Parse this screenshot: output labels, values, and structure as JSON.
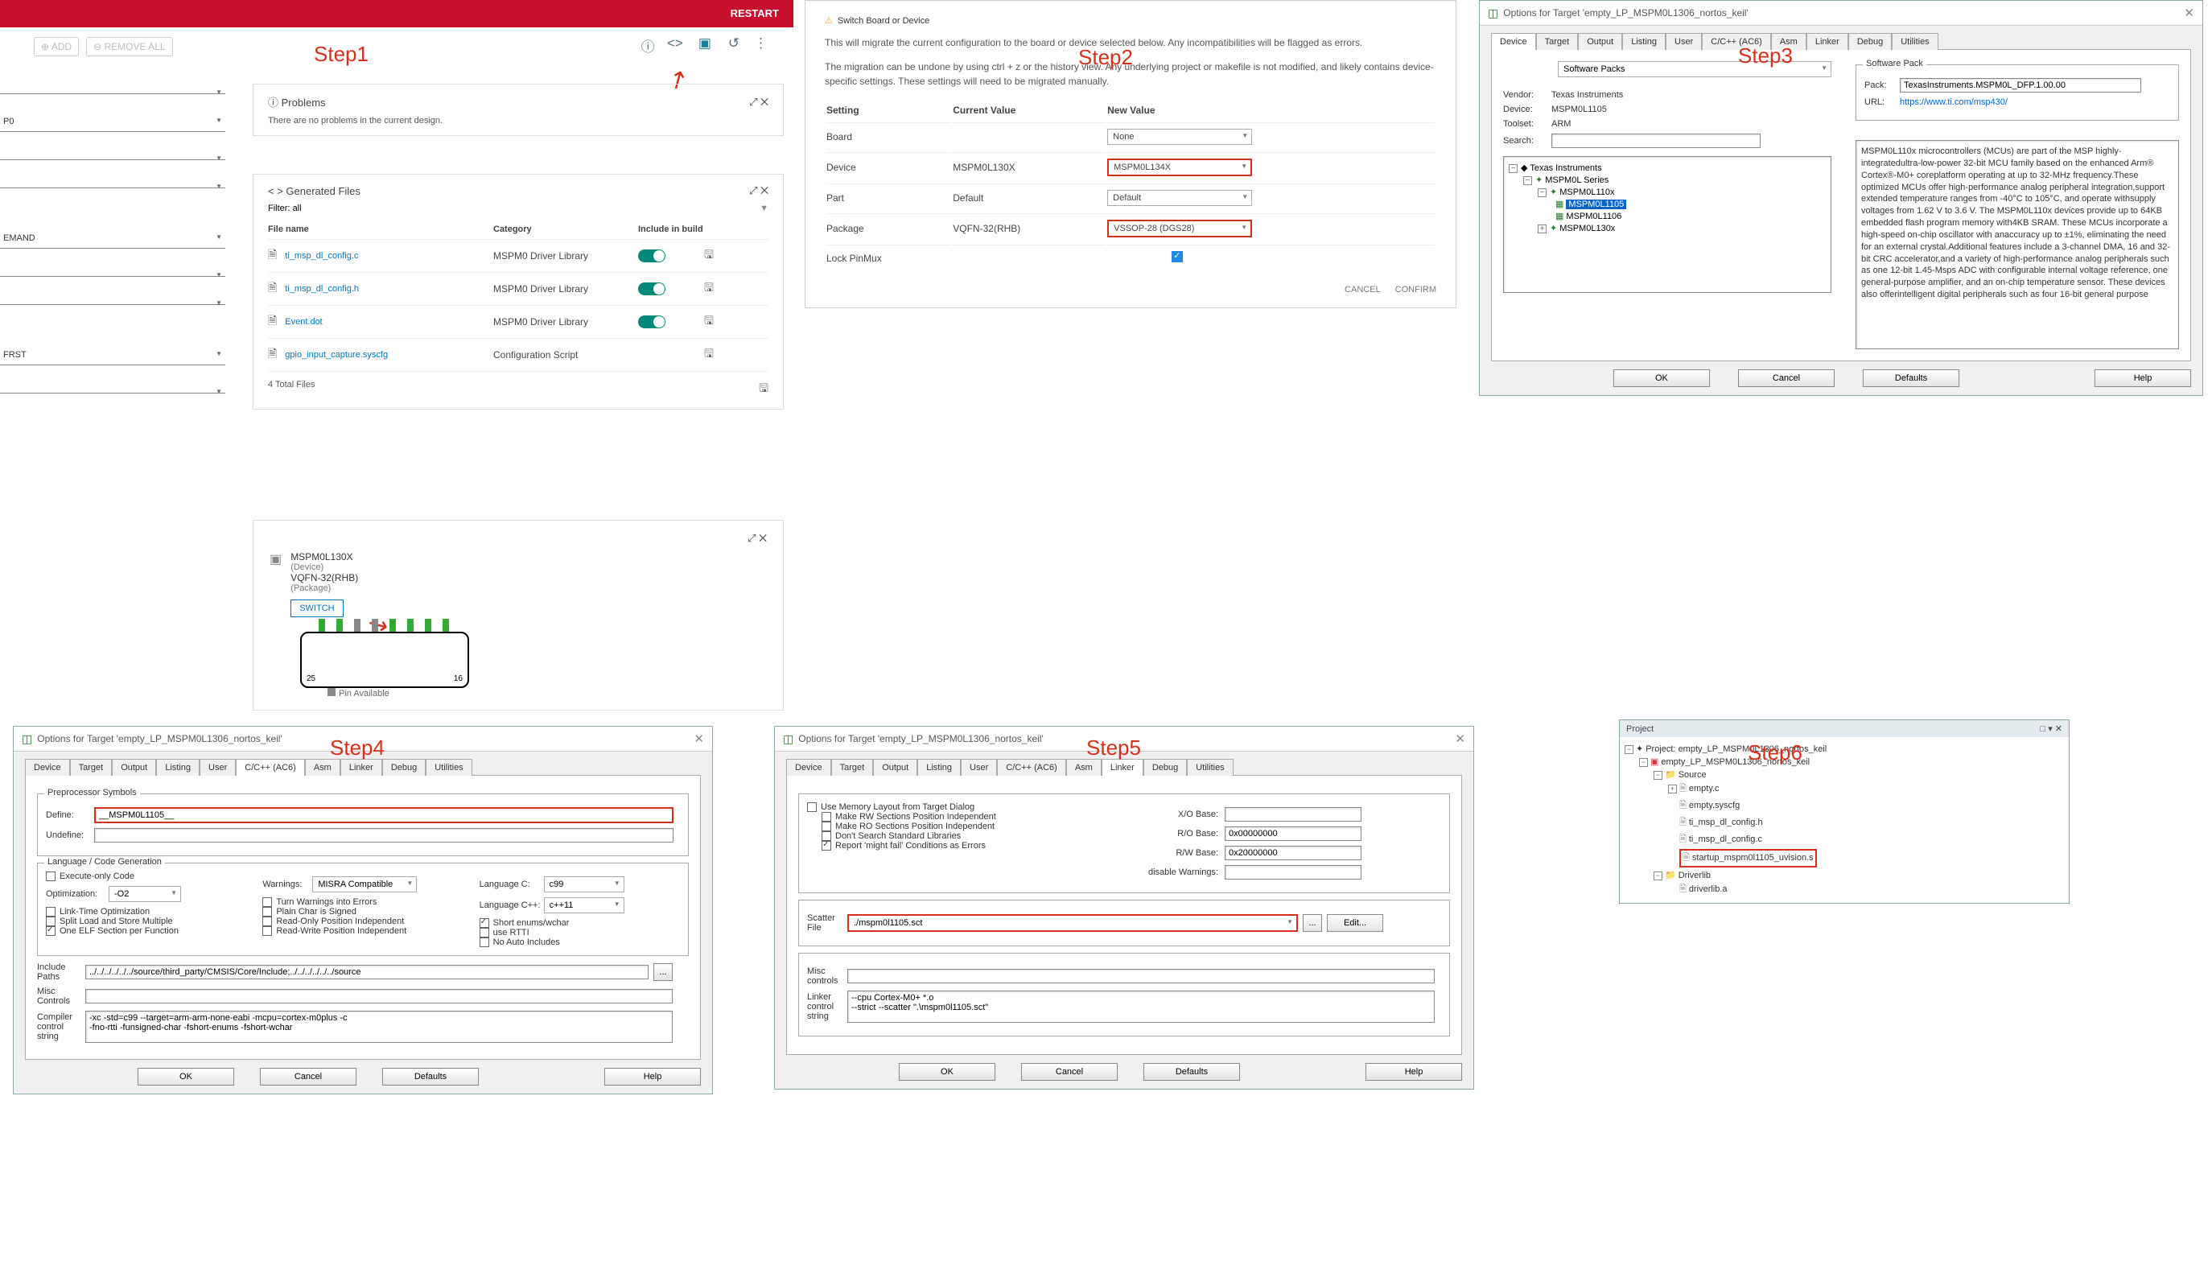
{
  "step_labels": [
    "Step1",
    "Step2",
    "Step3",
    "Step4",
    "Step5",
    "Step6"
  ],
  "restart": "RESTART",
  "left": {
    "add": "⊕ ADD",
    "remove": "⊖ REMOVE ALL",
    "drops": [
      "",
      "P0",
      "",
      "",
      "EMAND",
      "",
      "",
      "FRST",
      ""
    ]
  },
  "problems": {
    "title": "Problems",
    "msg": "There are no problems in the current design."
  },
  "genfiles": {
    "title": "Generated Files",
    "filter_lb": "Filter:",
    "filter": "all",
    "cols": [
      "File name",
      "Category",
      "Include in build"
    ],
    "rows": [
      {
        "name": "ti_msp_dl_config.c",
        "cat": "MSPM0 Driver Library",
        "tog": true
      },
      {
        "name": "ti_msp_dl_config.h",
        "cat": "MSPM0 Driver Library",
        "tog": true
      },
      {
        "name": "Event.dot",
        "cat": "MSPM0 Driver Library",
        "tog": true
      },
      {
        "name": "gpio_input_capture.syscfg",
        "cat": "Configuration Script",
        "tog": false
      }
    ],
    "total": "4 Total Files"
  },
  "device": {
    "name": "MSPM0L130X",
    "dev": "(Device)",
    "pkg": "VQFN-32(RHB)",
    "pkg2": "(Package)",
    "switch": "SWITCH",
    "pin_avail": "Pin Available",
    "p25": "25",
    "p16": "16"
  },
  "switchdlg": {
    "title": "Switch Board or Device",
    "p1": "This will migrate the current configuration to the board or device selected below. Any incompatibilities will be flagged as errors.",
    "p2": "The migration can be undone by using ctrl + z or the history view. Any underlying project or makefile is not modified, and likely contains device-specific settings. These settings will need to be migrated manually.",
    "cols": [
      "Setting",
      "Current Value",
      "New Value"
    ],
    "rows": [
      {
        "s": "Board",
        "c": "",
        "n": "None"
      },
      {
        "s": "Device",
        "c": "MSPM0L130X",
        "n": "MSPM0L134X"
      },
      {
        "s": "Part",
        "c": "Default",
        "n": "Default"
      },
      {
        "s": "Package",
        "c": "VQFN-32(RHB)",
        "n": "VSSOP-28 (DGS28)"
      },
      {
        "s": "Lock PinMux",
        "c": "",
        "n": "__check__"
      }
    ],
    "cancel": "CANCEL",
    "confirm": "CONFIRM"
  },
  "keil_dev": {
    "title": "Options for Target 'empty_LP_MSPM0L1306_nortos_keil'",
    "tabs": [
      "Device",
      "Target",
      "Output",
      "Listing",
      "User",
      "C/C++ (AC6)",
      "Asm",
      "Linker",
      "Debug",
      "Utilities"
    ],
    "soft": "Software Packs",
    "vendor_l": "Vendor:",
    "vendor": "Texas Instruments",
    "device_l": "Device:",
    "device": "MSPM0L1105",
    "tool_l": "Toolset:",
    "tool": "ARM",
    "search_l": "Search:",
    "tree": [
      "Texas Instruments",
      "MSPM0L Series",
      "MSPM0L110x",
      "MSPM0L1105",
      "MSPM0L1106",
      "MSPM0L130x"
    ],
    "sp_t": "Software Pack",
    "pack_l": "Pack:",
    "pack": "TexasInstruments.MSPM0L_DFP.1.00.00",
    "url_l": "URL:",
    "url": "https://www.ti.com/msp430/",
    "desc": "MSPM0L110x microcontrollers (MCUs) are part of the MSP highly-integratedultra-low-power 32-bit MCU family based on the enhanced Arm® Cortex®-M0+ coreplatform operating at up to 32-MHz frequency.These optimized MCUs offer high-performance analog peripheral integration,support extended temperature ranges from -40°C to 105°C, and operate withsupply voltages from 1.62 V to 3.6 V. The MSPM0L110x devices provide up to 64KB embedded flash program memory with4KB SRAM. These MCUs incorporate a high-speed on-chip oscillator with anaccuracy up to ±1%, eliminating the need for an external crystal.Additional features include a 3-channel DMA, 16 and 32-bit CRC accelerator,and a variety of high-performance analog peripherals such as one 12-bit 1.45-Msps ADC with configurable internal voltage reference, one general-purpose amplifier, and an on-chip temperature sensor. These devices also offerintelligent digital peripherals such as four 16-bit general purpose",
    "btns": [
      "OK",
      "Cancel",
      "Defaults",
      "Help"
    ]
  },
  "keil_cc": {
    "title": "Options for Target 'empty_LP_MSPM0L1306_nortos_keil'",
    "tabs": [
      "Device",
      "Target",
      "Output",
      "Listing",
      "User",
      "C/C++ (AC6)",
      "Asm",
      "Linker",
      "Debug",
      "Utilities"
    ],
    "pre_t": "Preprocessor Symbols",
    "def_l": "Define:",
    "def": "__MSPM0L1105__",
    "undef_l": "Undefine:",
    "lang_t": "Language / Code Generation",
    "opts": [
      "Execute-only Code",
      "Link-Time Optimization",
      "Split Load and Store Multiple",
      "One ELF Section per Function",
      "Turn Warnings into Errors",
      "Plain Char is Signed",
      "Read-Only Position Independent",
      "Read-Write Position Independent",
      "Short enums/wchar",
      "use RTTI",
      "No Auto Includes"
    ],
    "warn_l": "Warnings:",
    "warn": "MISRA Compatible",
    "opt_l": "Optimization:",
    "opt": "-O2",
    "langc_l": "Language C:",
    "langc": "c99",
    "langcpp_l": "Language C++:",
    "langcpp": "c++11",
    "inc_l": "Include Paths",
    "inc": "../../../../../../source/third_party/CMSIS/Core/Include;../../../../../../source",
    "misc_l": "Misc Controls",
    "cc_l": "Compiler control string",
    "cc": "-xc -std=c99 --target=arm-arm-none-eabi -mcpu=cortex-m0plus -c\n-fno-rtti -funsigned-char -fshort-enums -fshort-wchar",
    "btns": [
      "OK",
      "Cancel",
      "Defaults",
      "Help"
    ]
  },
  "keil_lk": {
    "title": "Options for Target 'empty_LP_MSPM0L1306_nortos_keil'",
    "tabs": [
      "Device",
      "Target",
      "Output",
      "Listing",
      "User",
      "C/C++ (AC6)",
      "Asm",
      "Linker",
      "Debug",
      "Utilities"
    ],
    "opts": [
      "Use Memory Layout from Target Dialog",
      "Make RW Sections Position Independent",
      "Make RO Sections Position Independent",
      "Don't Search Standard Libraries",
      "Report 'might fail' Conditions as Errors"
    ],
    "xo": "X/O Base:",
    "ro": "R/O Base:",
    "ro_v": "0x00000000",
    "rw": "R/W Base:",
    "rw_v": "0x20000000",
    "dw": "disable Warnings:",
    "scat_l": "Scatter File",
    "scat": "./mspm0l1105.sct",
    "edit": "Edit...",
    "misc_l": "Misc controls",
    "lc_l": "Linker control string",
    "lc": "--cpu Cortex-M0+ *.o\n--strict --scatter \".\\mspm0l1105.sct\"",
    "btns": [
      "OK",
      "Cancel",
      "Defaults",
      "Help"
    ]
  },
  "proj": {
    "title": "Project",
    "root": "Project: empty_LP_MSPM0L1306_nortos_keil",
    "targ": "empty_LP_MSPM0L1306_nortos_keil",
    "src": "Source",
    "files": [
      "empty.c",
      "empty.syscfg",
      "ti_msp_dl_config.h",
      "ti_msp_dl_config.c",
      "startup_mspm0l1105_uvision.s"
    ],
    "drv": "Driverlib",
    "drvf": "driverlib.a"
  }
}
